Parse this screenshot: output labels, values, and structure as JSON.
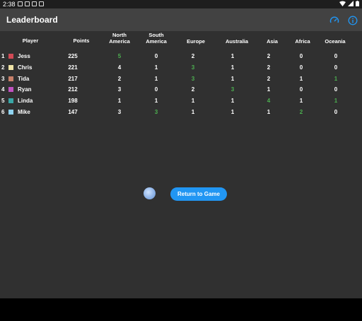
{
  "status_bar": {
    "time": "2:38"
  },
  "app_bar": {
    "title": "Leaderboard"
  },
  "columns": {
    "player": "Player",
    "points": "Points",
    "north_america": [
      "North",
      "America"
    ],
    "south_america": [
      "South",
      "America"
    ],
    "europe": "Europe",
    "australia": "Australia",
    "asia": "Asia",
    "africa": "Africa",
    "oceania": "Oceania"
  },
  "rows": [
    {
      "rank": "1",
      "name": "Jess",
      "color": "#d14a55",
      "points": "225",
      "na": "5",
      "sa": "0",
      "eu": "2",
      "au": "1",
      "as": "2",
      "af": "0",
      "oc": "0",
      "green": [
        "na"
      ]
    },
    {
      "rank": "2",
      "name": "Chris",
      "color": "#efe3a6",
      "points": "221",
      "na": "4",
      "sa": "1",
      "eu": "3",
      "au": "1",
      "as": "2",
      "af": "0",
      "oc": "0",
      "green": [
        "eu"
      ]
    },
    {
      "rank": "3",
      "name": "Tida",
      "color": "#c8806a",
      "points": "217",
      "na": "2",
      "sa": "1",
      "eu": "3",
      "au": "1",
      "as": "2",
      "af": "1",
      "oc": "1",
      "green": [
        "eu",
        "oc"
      ]
    },
    {
      "rank": "4",
      "name": "Ryan",
      "color": "#c052c0",
      "points": "212",
      "na": "3",
      "sa": "0",
      "eu": "2",
      "au": "3",
      "as": "1",
      "af": "0",
      "oc": "0",
      "green": [
        "au"
      ]
    },
    {
      "rank": "5",
      "name": "Linda",
      "color": "#3aa6a6",
      "points": "198",
      "na": "1",
      "sa": "1",
      "eu": "1",
      "au": "1",
      "as": "4",
      "af": "1",
      "oc": "1",
      "green": [
        "as",
        "oc"
      ]
    },
    {
      "rank": "6",
      "name": "Mike",
      "color": "#8fd3f0",
      "points": "147",
      "na": "3",
      "sa": "3",
      "eu": "1",
      "au": "1",
      "as": "1",
      "af": "2",
      "oc": "0",
      "green": [
        "sa",
        "af"
      ]
    }
  ],
  "actions": {
    "return_label": "Return to Game"
  },
  "icons": {
    "speed": "speedometer-icon",
    "info": "info-icon",
    "globe": "globe-icon"
  },
  "colors": {
    "accent": "#2196f3",
    "highlight": "#4caf50"
  }
}
